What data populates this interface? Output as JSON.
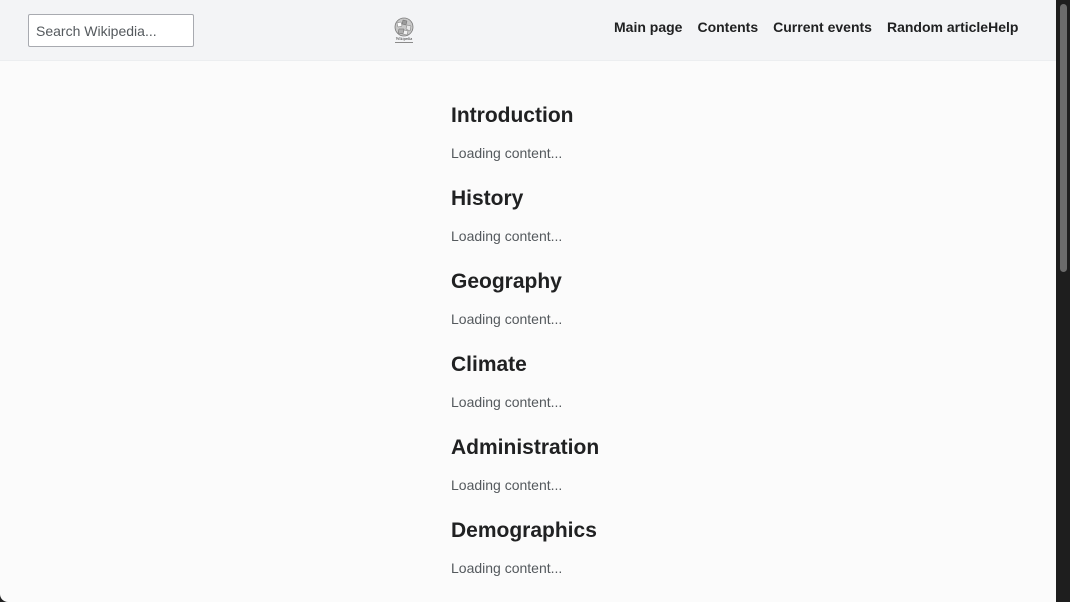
{
  "search": {
    "placeholder": "Search Wikipedia..."
  },
  "logo": {
    "icon": "wikipedia-globe-icon",
    "wordmark": "Wikipedia"
  },
  "nav": {
    "items": [
      {
        "label": "Main page"
      },
      {
        "label": "Contents"
      },
      {
        "label": "Current events"
      },
      {
        "label": "Random article"
      },
      {
        "label": "Help"
      }
    ]
  },
  "sections": [
    {
      "title": "Introduction",
      "body": "Loading content..."
    },
    {
      "title": "History",
      "body": "Loading content..."
    },
    {
      "title": "Geography",
      "body": "Loading content..."
    },
    {
      "title": "Climate",
      "body": "Loading content..."
    },
    {
      "title": "Administration",
      "body": "Loading content..."
    },
    {
      "title": "Demographics",
      "body": "Loading content..."
    }
  ],
  "colors": {
    "header_bg": "#f3f4f6",
    "page_bg": "#fbfbfb",
    "text": "#202122",
    "muted_text": "#54595d"
  }
}
